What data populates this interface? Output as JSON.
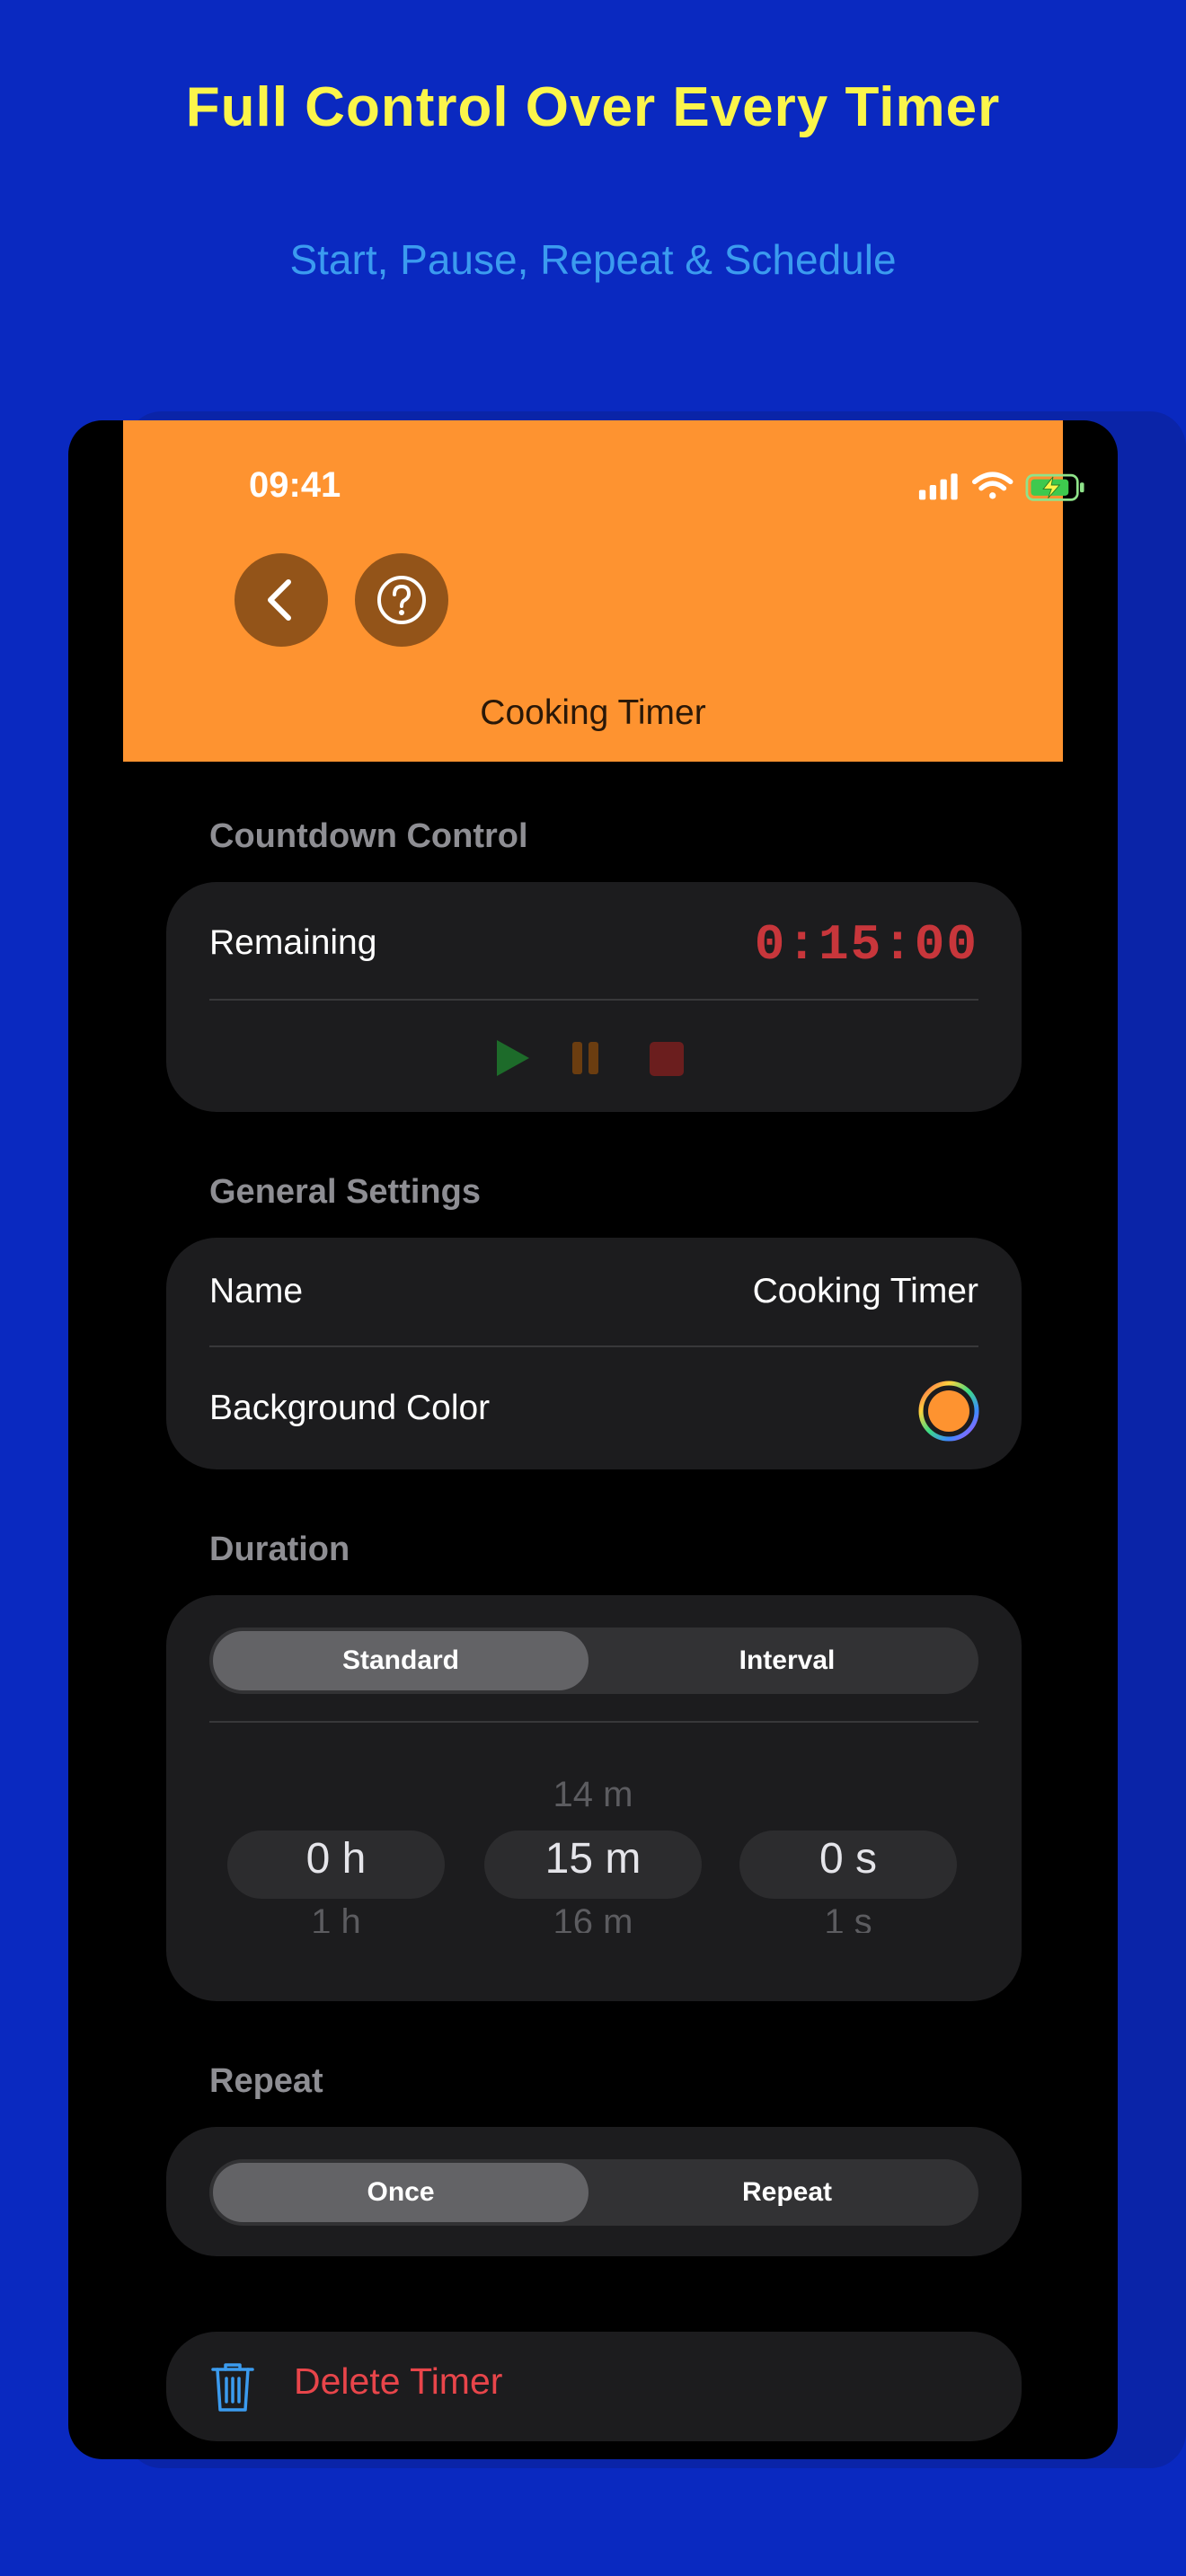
{
  "marketing": {
    "headline": "Full Control Over Every Timer",
    "subheadline": "Start, Pause, Repeat & Schedule"
  },
  "status_bar": {
    "time": "09:41"
  },
  "header": {
    "title": "Cooking Timer",
    "back_icon": "chevron-left-icon",
    "help_icon": "question-circle-icon",
    "color": "#fe9330"
  },
  "countdown": {
    "section_label": "Countdown Control",
    "remaining_label": "Remaining",
    "remaining_value": "0:15:00",
    "controls": [
      "play-icon",
      "pause-icon",
      "stop-icon"
    ]
  },
  "general": {
    "section_label": "General Settings",
    "name_label": "Name",
    "name_value": "Cooking Timer",
    "bg_color_label": "Background Color",
    "bg_color_value": "#fe9330"
  },
  "duration": {
    "section_label": "Duration",
    "modes": [
      "Standard",
      "Interval"
    ],
    "selected_mode": "Standard",
    "picker": {
      "hours": {
        "above": "",
        "selected": "0 h",
        "below": "1 h"
      },
      "minutes": {
        "above": "14 m",
        "selected": "15 m",
        "below": "16 m"
      },
      "seconds": {
        "above": "",
        "selected": "0 s",
        "below": "1 s"
      }
    }
  },
  "repeat": {
    "section_label": "Repeat",
    "options": [
      "Once",
      "Repeat"
    ],
    "selected": "Once"
  },
  "delete": {
    "label": "Delete Timer",
    "icon": "trash-icon"
  }
}
